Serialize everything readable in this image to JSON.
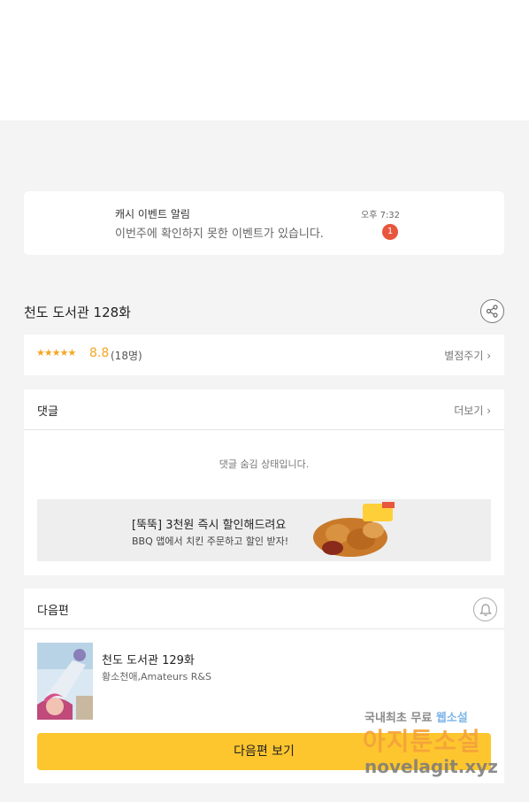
{
  "notification": {
    "title": "캐시 이벤트 알림",
    "body": "이번주에 확인하지 못한 이벤트가 있습니다.",
    "time": "오후 7:32",
    "badge": "1"
  },
  "episode": {
    "title": "천도 도서관 128화"
  },
  "rating": {
    "stars": "★★★★★",
    "score": "8.8",
    "count": "(18명)",
    "give_label": "별점주기 ›"
  },
  "comments": {
    "label": "댓글",
    "more": "더보기 ›",
    "hidden_text": "댓글 숨김 상태입니다."
  },
  "ad": {
    "headline": "[뚝뚝] 3천원 즉시 할인해드려요",
    "sub": "BBQ 앱에서 치킨 주문하고 할인 받자!"
  },
  "next": {
    "label": "다음편",
    "title": "천도 도서관 129화",
    "author": "황소천애,Amateurs R&S",
    "button": "다음편 보기"
  },
  "watermark": {
    "line1_a": "국내최초 무료",
    "line1_b": "웹소설",
    "line2": "아지툰소설",
    "line3": "novelagit.xyz"
  },
  "colors": {
    "accent_yellow": "#fec62e",
    "star_orange": "#f5a623",
    "badge_red": "#e8563d"
  }
}
